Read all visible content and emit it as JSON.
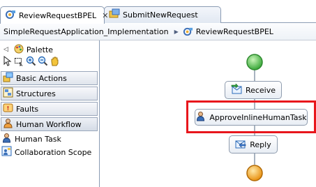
{
  "editor_tabs": [
    {
      "label": "ReviewRequestBPEL",
      "active": true,
      "icon": "bpel-process-icon",
      "close_glyph": "✕"
    },
    {
      "label": "SubmitNewRequest",
      "active": false,
      "icon": "submit-request-icon"
    }
  ],
  "breadcrumb": {
    "items": [
      "SimpleRequestApplication_Implementation",
      "ReviewRequestBPEL"
    ],
    "separator_glyph": "▶"
  },
  "palette": {
    "title": "Palette",
    "collapse_glyph": "◁",
    "tools": [
      "select-tool-icon",
      "marquee-tool-icon",
      "zoom-in-icon",
      "zoom-out-icon",
      "hand-tool-icon"
    ],
    "drawers": [
      {
        "label": "Basic Actions",
        "icon": "basic-actions-icon"
      },
      {
        "label": "Structures",
        "icon": "structures-icon"
      },
      {
        "label": "Faults",
        "icon": "faults-icon"
      },
      {
        "label": "Human Workflow",
        "icon": "human-workflow-icon",
        "open": true
      }
    ],
    "entries": [
      {
        "label": "Human Task",
        "icon": "human-task-icon"
      },
      {
        "label": "Collaboration Scope",
        "icon": "collaboration-scope-icon"
      }
    ]
  },
  "process": {
    "activities": [
      {
        "label": "Receive",
        "icon": "receive-icon"
      },
      {
        "label": "ApproveInlineHumanTask",
        "icon": "human-task-icon",
        "selected": true
      },
      {
        "label": "Reply",
        "icon": "reply-icon"
      }
    ],
    "start_color": "#4fc24a",
    "end_color": "#f0a020",
    "highlight_color": "#e8161c"
  }
}
